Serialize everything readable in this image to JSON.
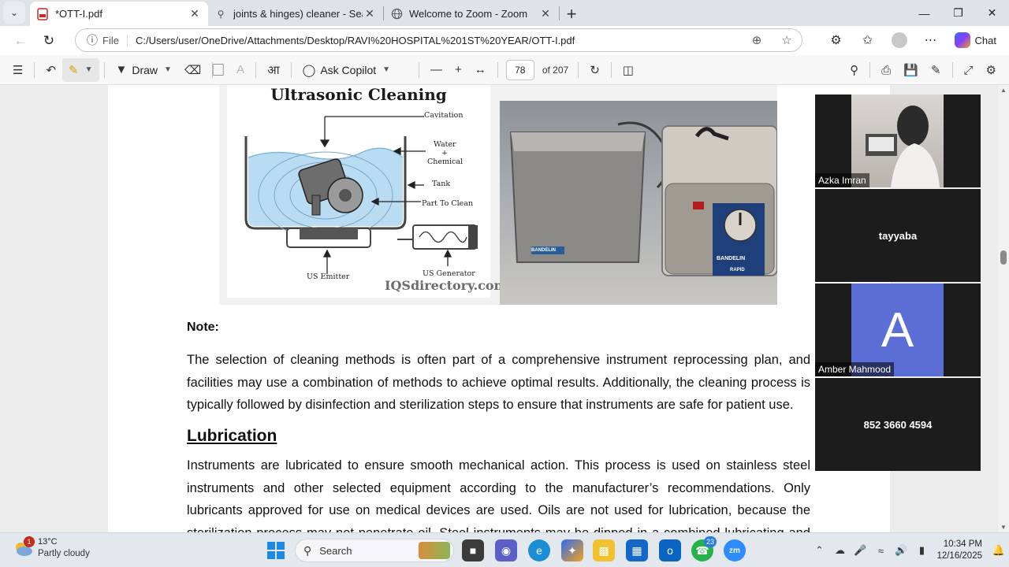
{
  "browser": {
    "tabs": [
      {
        "title": "*OTT-I.pdf",
        "icon": "pdf-icon",
        "active": true
      },
      {
        "title": "joints & hinges) cleaner - Search",
        "icon": "search-icon",
        "active": false
      },
      {
        "title": "Welcome to Zoom - Zoom",
        "icon": "globe-icon",
        "active": false
      }
    ],
    "address": {
      "scheme_label": "File",
      "url": "C:/Users/user/OneDrive/Attachments/Desktop/RAVI%20HOSPITAL%201ST%20YEAR/OTT-I.pdf"
    },
    "chat_label": "Chat"
  },
  "pdf_toolbar": {
    "draw_label": "Draw",
    "ask_copilot_label": "Ask Copilot",
    "page_current": "78",
    "page_total": "of 207"
  },
  "figure": {
    "title": "Ultrasonic Cleaning",
    "labels": {
      "cavitation": "Cavitation",
      "water": "Water",
      "plus": "+",
      "chemical": "Chemical",
      "tank": "Tank",
      "part_to_clean": "Part To Clean",
      "us_emitter": "US Emitter",
      "us_generator": "US Generator"
    },
    "brand": "IQSdirectory.com",
    "device_brand": "BANDELIN",
    "device_model": "RAPID"
  },
  "document": {
    "note_heading": "Note:",
    "note_paragraph": "The selection of cleaning methods is often part of a comprehensive instrument reprocessing plan, and facilities may use a combination of methods to achieve optimal results. Additionally, the cleaning process is typically followed by disinfection and sterilization steps to ensure that instruments are safe for patient use.",
    "section_heading": "Lubrication",
    "section_paragraph": "Instruments are lubricated to ensure smooth mechanical action. This process is used on stainless steel instruments and other selected equipment according to the manufacturer’s recommendations. Only lubricants approved for use on medical devices are used. Oils are not used for lubrication, because the sterilization process may not penetrate oil. Steel instruments may be dipped in a combined lubricating and protective"
  },
  "zoom_participants": [
    {
      "name": "Azka Imran",
      "type": "video"
    },
    {
      "name": "tayyaba",
      "type": "name"
    },
    {
      "name": "Amber Mahmood",
      "type": "avatar",
      "initial": "A"
    },
    {
      "name": "852 3660 4594",
      "type": "name"
    }
  ],
  "taskbar": {
    "weather_temp": "13°C",
    "weather_desc": "Partly cloudy",
    "weather_badge": "1",
    "search_label": "Search",
    "whatsapp_badge": "23",
    "time": "10:34 PM",
    "date": "12/16/2025"
  }
}
